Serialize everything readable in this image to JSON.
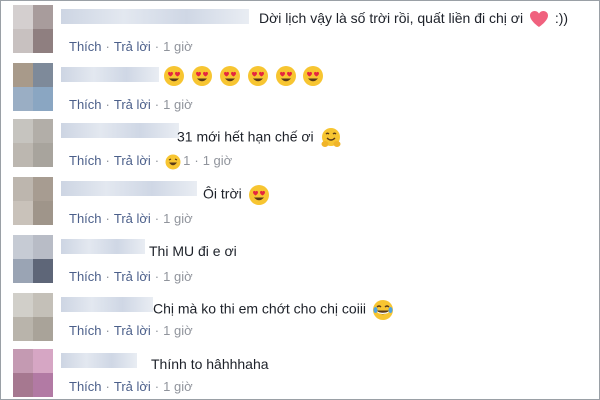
{
  "actions": {
    "like": "Thích",
    "reply": "Trả lời",
    "separator": "·"
  },
  "colors": {
    "link": "#4b5f8a",
    "meta": "#90949c",
    "text": "#1d2129",
    "heart": "#f0617e"
  },
  "comments": [
    {
      "text": "Dời lịch vậy là số trời rồi, quất liền đi chị ơi",
      "suffix": ":))",
      "emojis": [
        "heart-icon"
      ],
      "time": "1 giờ"
    },
    {
      "text": "",
      "suffix": "",
      "emojis": [
        "heart-eyes-icon",
        "heart-eyes-icon",
        "heart-eyes-icon",
        "heart-eyes-icon",
        "heart-eyes-icon",
        "heart-eyes-icon"
      ],
      "time": "1 giờ"
    },
    {
      "text": "31 mới hết hạn chế ơi",
      "suffix": "",
      "emojis": [
        "hug-face-icon"
      ],
      "time": "1 giờ",
      "reaction": {
        "icon": "haha-reaction-icon",
        "count": "1"
      }
    },
    {
      "text": "Ôi trời",
      "suffix": "",
      "emojis": [
        "heart-eyes-icon"
      ],
      "time": "1 giờ"
    },
    {
      "text": "Thi MU đi e ơi",
      "suffix": "",
      "emojis": [],
      "time": "1 giờ"
    },
    {
      "text": "Chị mà ko thi em chớt cho chị coiii",
      "suffix": "",
      "emojis": [
        "tears-of-joy-icon"
      ],
      "time": "1 giờ"
    },
    {
      "text": "Thính to hâhhhaha",
      "suffix": "",
      "emojis": [],
      "time": "1 giờ"
    }
  ]
}
